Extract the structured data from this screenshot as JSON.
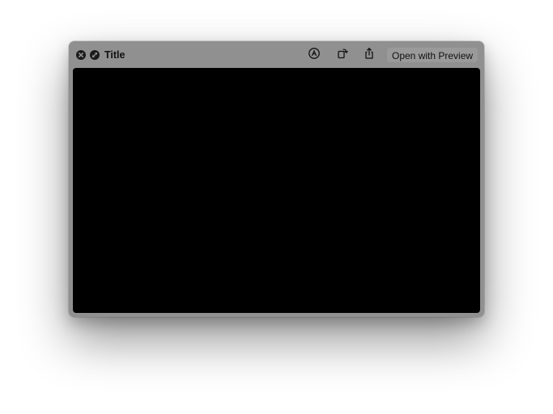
{
  "window": {
    "title": "Title",
    "open_button_label": "Open with Preview"
  },
  "toolbar": {
    "icons": [
      "markup-icon",
      "rotate-icon",
      "share-icon"
    ]
  },
  "titlebar_buttons": [
    "close-icon",
    "fullscreen-icon"
  ],
  "colors": {
    "window_chrome": "#909090",
    "preview_background": "#000000",
    "text": "#111111"
  }
}
